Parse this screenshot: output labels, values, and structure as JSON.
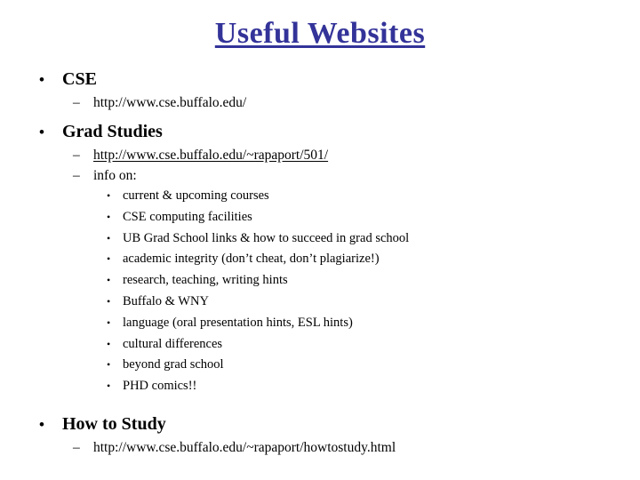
{
  "slide": {
    "title": "Useful Websites",
    "title_color": "#333399",
    "background_color": "#ffffff"
  },
  "outline": {
    "cse_heading": "CSE",
    "cse_url": "http://www.cse.buffalo.edu/",
    "grad_heading": "Grad Studies",
    "grad_url": "http://www.cse.buffalo.edu/~rapaport/501/",
    "info_on": "info on:",
    "info_items": [
      "current & upcoming courses",
      "CSE computing facilities",
      "UB Grad School links & how to succeed in grad school",
      "academic integrity (don’t cheat, don’t plagiarize!)",
      "research, teaching, writing hints",
      "Buffalo & WNY",
      "language (oral presentation hints, ESL hints)",
      "cultural differences",
      "beyond grad school",
      "PHD comics!!"
    ],
    "howto_heading": "How to Study",
    "howto_url": "http://www.cse.buffalo.edu/~rapaport/howtostudy.html"
  },
  "markers": {
    "level1": "•",
    "level2": "–",
    "level3": "•"
  }
}
